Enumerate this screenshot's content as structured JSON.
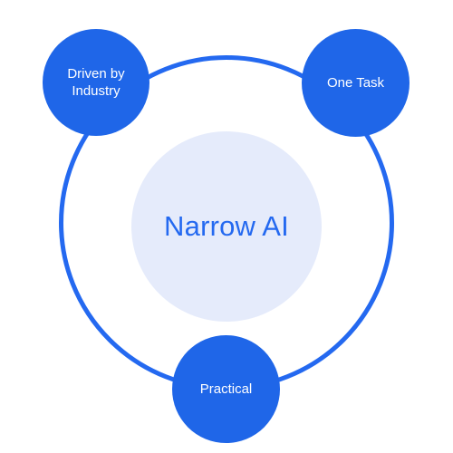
{
  "diagram": {
    "center": {
      "label": "Narrow AI"
    },
    "nodes": [
      {
        "label": "Driven by Industry"
      },
      {
        "label": "One Task"
      },
      {
        "label": "Practical"
      }
    ]
  },
  "colors": {
    "ring": "#2469f0",
    "node_fill": "#1f66e8",
    "center_fill": "#e5ebfb",
    "center_text": "#2469f0",
    "node_text": "#ffffff"
  }
}
